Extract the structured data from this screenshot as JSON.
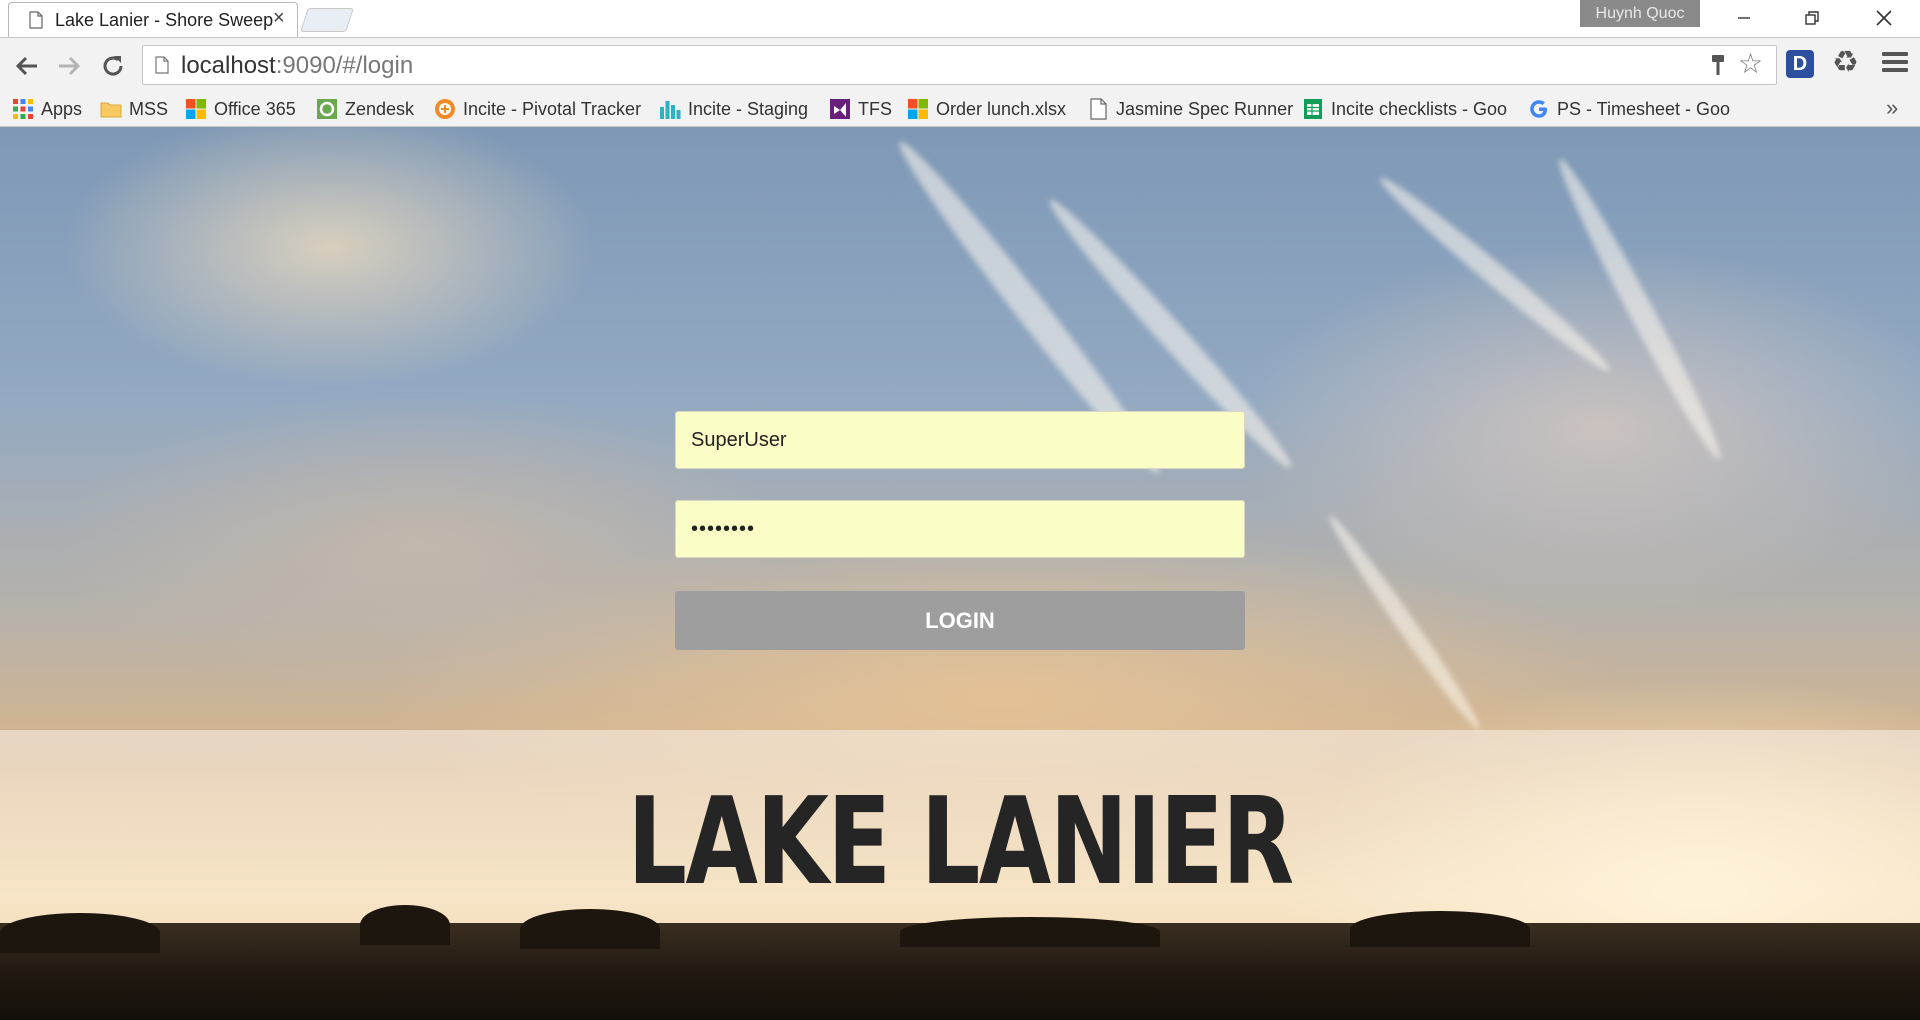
{
  "browser": {
    "tab": {
      "title": "Lake Lanier - Shore Sweep",
      "close_glyph": "×"
    },
    "profile_name": "Huynh Quoc",
    "address": {
      "host": "localhost",
      "path": ":9090/#/login"
    },
    "bookmarks": [
      {
        "label": "Apps",
        "icon": "apps-grid-icon"
      },
      {
        "label": "MSS",
        "icon": "folder-icon"
      },
      {
        "label": "Office 365",
        "icon": "microsoft-icon"
      },
      {
        "label": "Zendesk",
        "icon": "zendesk-icon"
      },
      {
        "label": "Incite - Pivotal Tracker",
        "icon": "pivotal-icon"
      },
      {
        "label": "Incite - Staging",
        "icon": "bar-chart-icon"
      },
      {
        "label": "TFS",
        "icon": "visual-studio-icon"
      },
      {
        "label": "Order lunch.xlsx",
        "icon": "microsoft-icon"
      },
      {
        "label": "Jasmine Spec Runner",
        "icon": "page-icon"
      },
      {
        "label": "Incite checklists - Goo",
        "icon": "sheets-icon"
      },
      {
        "label": "PS - Timesheet - Goo",
        "icon": "google-icon"
      }
    ],
    "bookmarks_more": "»"
  },
  "login": {
    "username_value": "SuperUser",
    "password_value": "••••••••",
    "login_label": "LOGIN"
  },
  "brand": {
    "title": "LAKE LANIER"
  },
  "colors": {
    "input_bg": "#fafdc6",
    "button_bg": "#9e9e9e",
    "brand_text": "#252525"
  }
}
